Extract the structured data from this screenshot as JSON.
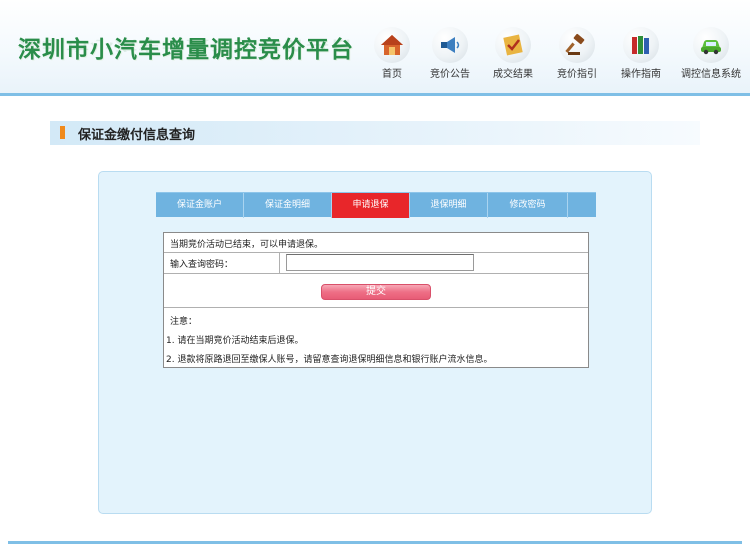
{
  "header": {
    "site_title": "深圳市小汽车增量调控竞价平台",
    "nav": [
      {
        "label": "首页",
        "icon": "home-icon"
      },
      {
        "label": "竞价公告",
        "icon": "megaphone-icon"
      },
      {
        "label": "成交结果",
        "icon": "certificate-icon"
      },
      {
        "label": "竞价指引",
        "icon": "gavel-icon"
      },
      {
        "label": "操作指南",
        "icon": "books-icon"
      },
      {
        "label": "调控信息系统",
        "icon": "car-icon"
      }
    ]
  },
  "section": {
    "title": "保证金缴付信息查询"
  },
  "tabs": [
    {
      "label": "保证金账户",
      "active": false
    },
    {
      "label": "保证金明细",
      "active": false
    },
    {
      "label": "申请退保",
      "active": true
    },
    {
      "label": "退保明细",
      "active": false
    },
    {
      "label": "修改密码",
      "active": false
    }
  ],
  "form": {
    "status_message": "当期竞价活动已结束，可以申请退保。",
    "password_label": "输入查询密码：",
    "password_value": "",
    "submit_label": "提交",
    "notes_title": "注意：",
    "notes": [
      "1. 请在当期竞价活动结束后退保。",
      "2. 退款将原路退回至缴保人账号，请留意查询退保明细信息和银行账户流水信息。"
    ]
  },
  "colors": {
    "title_green": "#2a8d4a",
    "tab_bar_blue": "#6fb3e0",
    "active_tab_red": "#e8262a",
    "panel_bg": "#e3f3fc",
    "accent_orange": "#f08a1c"
  }
}
